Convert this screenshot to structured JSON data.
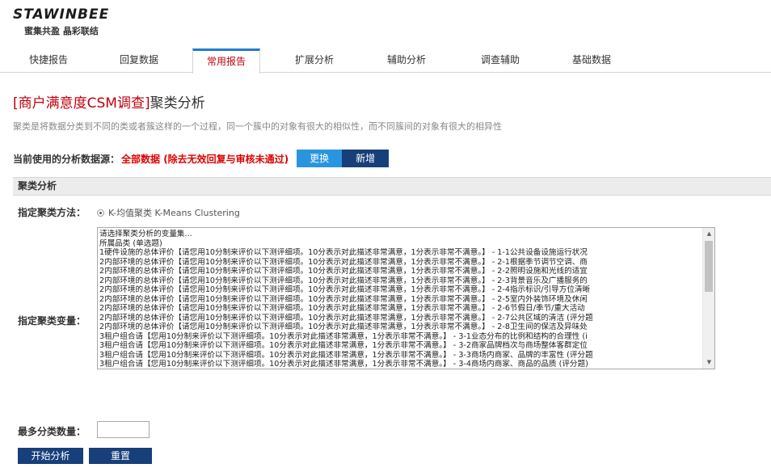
{
  "brand": {
    "logo": "STAWINBEE",
    "slogan": "蜜集共盈 晶彩联结"
  },
  "tabs": [
    {
      "label": "快捷报告",
      "active": false
    },
    {
      "label": "回复数据",
      "active": false
    },
    {
      "label": "常用报告",
      "active": true
    },
    {
      "label": "扩展分析",
      "active": false
    },
    {
      "label": "辅助分析",
      "active": false
    },
    {
      "label": "调查辅助",
      "active": false
    },
    {
      "label": "基础数据",
      "active": false
    }
  ],
  "page": {
    "title_bracket": "[商户满意度CSM调查]",
    "title_main": "聚类分析",
    "description": "聚类是将数据分类到不同的类或者簇这样的一个过程，同一个簇中的对象有很大的相似性，而不同簇间的对象有很大的相异性"
  },
  "source": {
    "label": "当前使用的分析数据源：",
    "value": "全部数据 (除去无效回复与审核未通过)",
    "change_label": "更换",
    "add_label": "新增"
  },
  "section": {
    "title": "聚类分析"
  },
  "form": {
    "method_label": "指定聚类方法：",
    "method_option": "K-均值聚类 K-Means Clustering",
    "variables_label": "指定聚类变量：",
    "variable_options": [
      "请选择聚类分析的变量集...",
      "所属品类 (单选题)",
      "1硬件设施的总体评价【请您用10分制来评价以下测评细项。10分表示对此描述非常满意，1分表示非常不满意。】 - 1-1公共设备设施运行状况",
      "2内部环境的总体评价【请您用10分制来评价以下测评细项。10分表示对此描述非常满意，1分表示非常不满意。】 - 2-1根据季节调节空调、商",
      "2内部环境的总体评价【请您用10分制来评价以下测评细项。10分表示对此描述非常满意，1分表示非常不满意。】 - 2-2照明设施和光线的适宜",
      "2内部环境的总体评价【请您用10分制来评价以下测评细项。10分表示对此描述非常满意，1分表示非常不满意。】 - 2-3背景音乐及广播服务的",
      "2内部环境的总体评价【请您用10分制来评价以下测评细项。10分表示对此描述非常满意，1分表示非常不满意。】 - 2-4指示标识/引导方位清晰",
      "2内部环境的总体评价【请您用10分制来评价以下测评细项。10分表示对此描述非常满意，1分表示非常不满意。】 - 2-5室内外装饰环境及休闲",
      "2内部环境的总体评价【请您用10分制来评价以下测评细项。10分表示对此描述非常满意，1分表示非常不满意。】 - 2-6节假日/季节/重大活动",
      "2内部环境的总体评价【请您用10分制来评价以下测评细项。10分表示对此描述非常满意，1分表示非常不满意。】 - 2-7公共区域的清洁 (评分题",
      "2内部环境的总体评价【请您用10分制来评价以下测评细项。10分表示对此描述非常满意，1分表示非常不满意。】 - 2-8卫生间的保洁及异味处",
      "3租户组合请【您用10分制来评价以下测评细项。10分表示对此描述非常满意，1分表示非常不满意。】 - 3-1业态分布的比例和结构的合理性 (i",
      "3租户组合请【您用10分制来评价以下测评细项。10分表示对此描述非常满意，1分表示非常不满意。】 - 3-2商家品牌档次与商场整体客群定位",
      "3租户组合请【您用10分制来评价以下测评细项。10分表示对此描述非常满意，1分表示非常不满意。】 - 3-3商场内商家、品牌的丰富性 (评分题",
      "3租户组合请【您用10分制来评价以下测评细项。10分表示对此描述非常满意，1分表示非常不满意。】 - 3-4商场内商家、商品的品质 (评分题)"
    ],
    "max_clusters_label": "最多分类数量：",
    "max_clusters_value": ""
  },
  "actions": {
    "start_label": "开始分析",
    "reset_label": "重置"
  },
  "colors": {
    "accent_red": "#c0000b",
    "source_red": "#e00000",
    "button_light": "#2a95df",
    "button_dark": "#173f7a",
    "tab_active_border": "#1f7ecc"
  }
}
